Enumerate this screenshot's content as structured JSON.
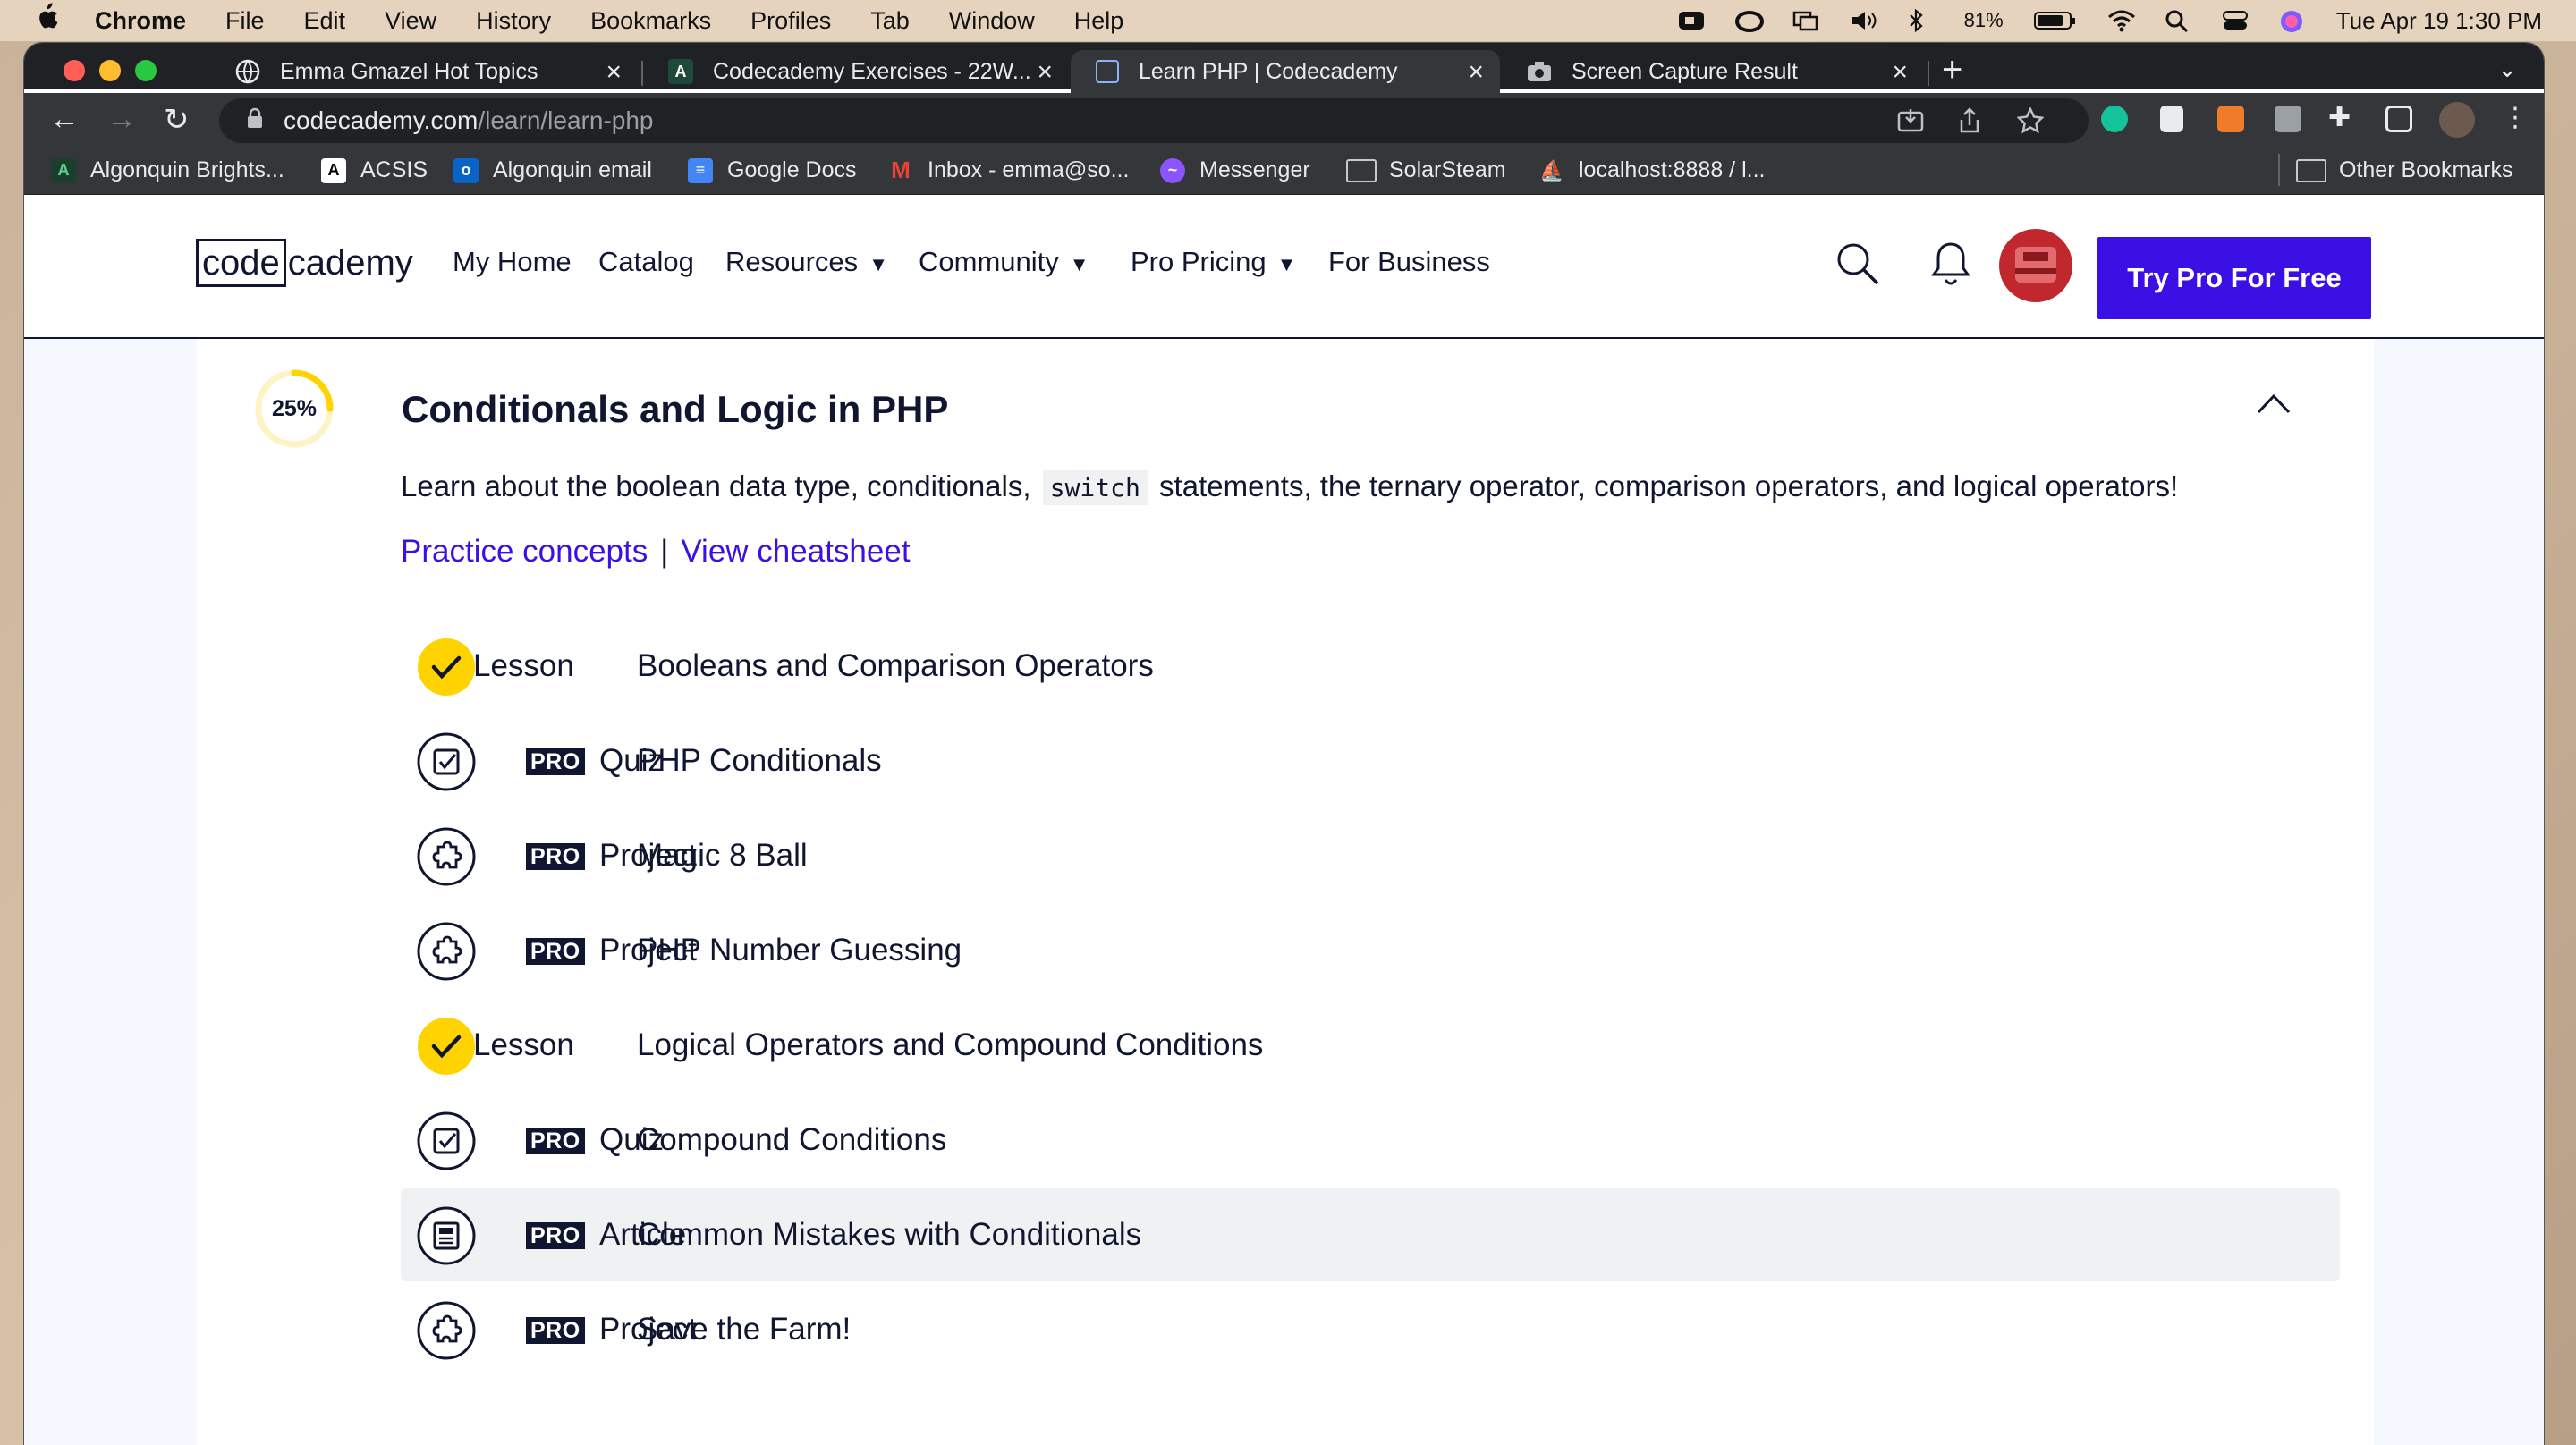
{
  "menubar": {
    "app": "Chrome",
    "items": [
      "File",
      "Edit",
      "View",
      "History",
      "Bookmarks",
      "Profiles",
      "Tab",
      "Window",
      "Help"
    ],
    "battery": "81%",
    "datetime": "Tue Apr 19  1:30 PM"
  },
  "tabs": [
    {
      "title": "Emma Gmazel Hot Topics",
      "icon": "globe-icon"
    },
    {
      "title": "Codecademy Exercises - 22W...",
      "icon": "codecademy-icon"
    },
    {
      "title": "Learn PHP | Codecademy",
      "icon": "codecademy-icon"
    },
    {
      "title": "Screen Capture Result",
      "icon": "camera-icon"
    }
  ],
  "address": {
    "host": "codecademy.com",
    "path": "/learn/learn-php"
  },
  "bookmarks": [
    {
      "label": "Algonquin Brights...",
      "icon": "algonquin-icon"
    },
    {
      "label": "ACSIS",
      "icon": "acsis-icon"
    },
    {
      "label": "Algonquin email",
      "icon": "outlook-icon"
    },
    {
      "label": "Google Docs",
      "icon": "docs-icon"
    },
    {
      "label": "Inbox - emma@so...",
      "icon": "gmail-icon"
    },
    {
      "label": "Messenger",
      "icon": "messenger-icon"
    },
    {
      "label": "SolarSteam",
      "icon": "folder-icon"
    },
    {
      "label": "localhost:8888 / l...",
      "icon": "phpmyadmin-icon"
    }
  ],
  "other_bookmarks": "Other Bookmarks",
  "site": {
    "logo_box": "code",
    "logo_rest": "cademy",
    "nav": [
      {
        "label": "My Home",
        "dropdown": false
      },
      {
        "label": "Catalog",
        "dropdown": false
      },
      {
        "label": "Resources",
        "dropdown": true
      },
      {
        "label": "Community",
        "dropdown": true
      },
      {
        "label": "Pro Pricing",
        "dropdown": true
      },
      {
        "label": "For Business",
        "dropdown": false
      }
    ],
    "cta": "Try Pro For Free"
  },
  "module": {
    "progress_label": "25%",
    "progress_fraction": 0.25,
    "title": "Conditionals and Logic in PHP",
    "desc_before": "Learn about the boolean data type, conditionals,",
    "desc_code": "switch",
    "desc_after": "statements, the ternary operator, comparison operators, and logical operators!",
    "link_practice": "Practice concepts",
    "link_sep": "|",
    "link_cheatsheet": "View cheatsheet",
    "pro_badge": "PRO",
    "items": [
      {
        "type": "Lesson",
        "title": "Booleans and Comparison Operators",
        "pro": false,
        "status": "completed"
      },
      {
        "type": "Quiz",
        "title": "PHP Conditionals",
        "pro": true,
        "status": "quiz"
      },
      {
        "type": "Project",
        "title": "Magic 8 Ball",
        "pro": true,
        "status": "project"
      },
      {
        "type": "Project",
        "title": "PHP Number Guessing",
        "pro": true,
        "status": "project"
      },
      {
        "type": "Lesson",
        "title": "Logical Operators and Compound Conditions",
        "pro": false,
        "status": "completed"
      },
      {
        "type": "Quiz",
        "title": "Compound Conditions",
        "pro": true,
        "status": "quiz"
      },
      {
        "type": "Article",
        "title": "Common Mistakes with Conditionals",
        "pro": true,
        "status": "article",
        "highlighted": true
      },
      {
        "type": "Project",
        "title": "Save the Farm!",
        "pro": true,
        "status": "project"
      }
    ]
  },
  "colors": {
    "brand": "#3a10e5",
    "navy": "#10162f",
    "yellow": "#ffd300",
    "page_bg": "#f5f8fe"
  }
}
